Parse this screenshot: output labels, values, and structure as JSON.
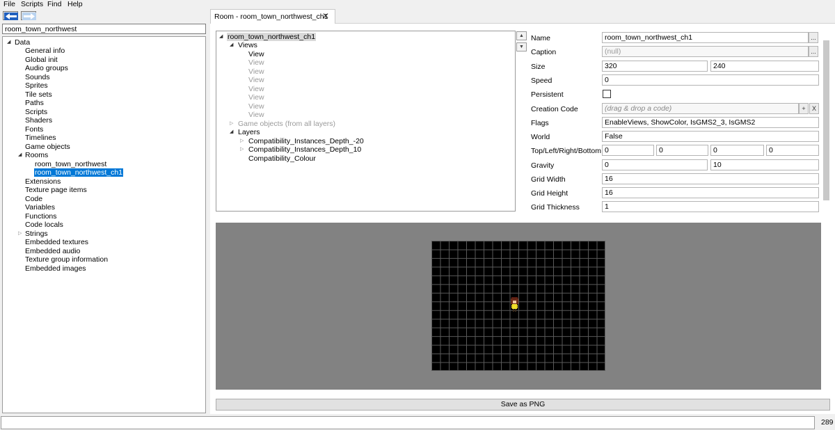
{
  "menu": [
    "File",
    "Scripts",
    "Find",
    "Help"
  ],
  "search": {
    "value": "room_town_northwest"
  },
  "tree": {
    "root": "Data",
    "items": [
      "General info",
      "Global init",
      "Audio groups",
      "Sounds",
      "Sprites",
      "Tile sets",
      "Paths",
      "Scripts",
      "Shaders",
      "Fonts",
      "Timelines",
      "Game objects"
    ],
    "rooms": {
      "label": "Rooms",
      "children": [
        "room_town_northwest",
        "room_town_northwest_ch1"
      ]
    },
    "after_rooms": [
      "Extensions",
      "Texture page items",
      "Code",
      "Variables",
      "Functions",
      "Code locals"
    ],
    "strings": "Strings",
    "tail": [
      "Embedded textures",
      "Embedded audio",
      "Texture group information",
      "Embedded images"
    ]
  },
  "tab": {
    "label": "Room - room_town_northwest_ch1",
    "close": "✕"
  },
  "room_tree": {
    "root": "room_town_northwest_ch1",
    "views_label": "Views",
    "views": [
      "View",
      "View",
      "View",
      "View",
      "View",
      "View",
      "View",
      "View"
    ],
    "game_objects": "Game objects (from all layers)",
    "layers_label": "Layers",
    "layers": [
      "Compatibility_Instances_Depth_-20",
      "Compatibility_Instances_Depth_10",
      "Compatibility_Colour"
    ]
  },
  "props": {
    "name_label": "Name",
    "name": "room_town_northwest_ch1",
    "caption_label": "Caption",
    "caption": "(null)",
    "size_label": "Size",
    "width": "320",
    "height": "240",
    "speed_label": "Speed",
    "speed": "0",
    "persistent_label": "Persistent",
    "code_label": "Creation Code",
    "code_placeholder": "(drag & drop a code)",
    "flags_label": "Flags",
    "flags": "EnableViews, ShowColor, IsGMS2_3, IsGMS2",
    "world_label": "World",
    "world": "False",
    "tlrb_label": "Top/Left/Right/Bottom",
    "top": "0",
    "left": "0",
    "right": "0",
    "bottom": "0",
    "gravity_label": "Gravity",
    "gravity_x": "0",
    "gravity_y": "10",
    "gridw_label": "Grid Width",
    "grid_width": "16",
    "gridh_label": "Grid Height",
    "grid_height": "16",
    "gridt_label": "Grid Thickness",
    "grid_thickness": "1",
    "browse": "...",
    "add": "+",
    "remove": "X"
  },
  "canvas": {
    "background": "#828282",
    "grid_color": "#000000",
    "line_color": "#5a5a5a"
  },
  "save_png": "Save as PNG",
  "status": {
    "count": "289"
  }
}
